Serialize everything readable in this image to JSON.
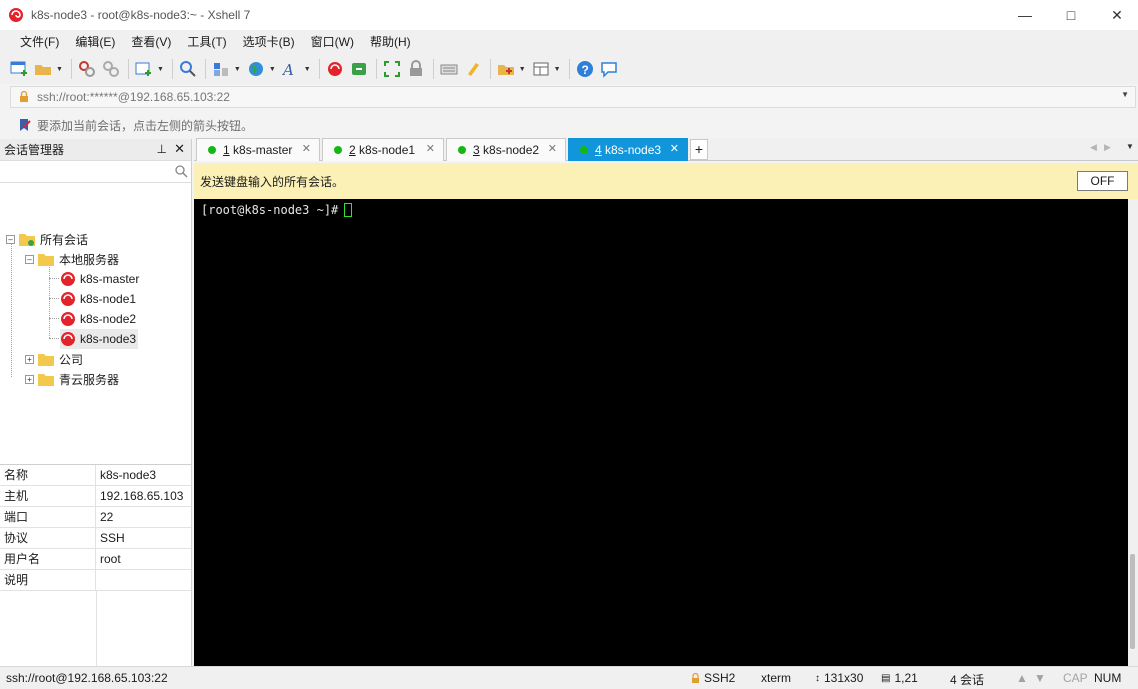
{
  "window": {
    "title": "k8s-node3 - root@k8s-node3:~ - Xshell 7",
    "minimize_icon": "minimize-icon",
    "maximize_icon": "maximize-icon",
    "close_icon": "close-icon"
  },
  "menu": [
    "文件(F)",
    "编辑(E)",
    "查看(V)",
    "工具(T)",
    "选项卡(B)",
    "窗口(W)",
    "帮助(H)"
  ],
  "toolbar_icons": [
    "new-session-icon",
    "open-folder-icon",
    "disconnect-icon",
    "reconnect-icon",
    "new-tab-icon",
    "find-icon",
    "transfer-icon",
    "globe-icon",
    "font-icon",
    "xshell-icon",
    "xftp-icon",
    "fullscreen-icon",
    "lock-icon",
    "keyboard-icon",
    "highlight-icon",
    "add-folder-icon",
    "layout-icon",
    "help-icon",
    "chat-icon"
  ],
  "address": {
    "value": "ssh://root:******@192.168.65.103:22"
  },
  "hint": {
    "text": "要添加当前会话，点击左侧的箭头按钮。"
  },
  "session_manager": {
    "title": "会话管理器",
    "tree": {
      "root": "所有会话",
      "local": "本地服务器",
      "sessions": [
        "k8s-master",
        "k8s-node1",
        "k8s-node2",
        "k8s-node3"
      ],
      "groups": [
        "公司",
        "青云服务器"
      ]
    },
    "properties": [
      {
        "key": "名称",
        "value": "k8s-node3"
      },
      {
        "key": "主机",
        "value": "192.168.65.103"
      },
      {
        "key": "端口",
        "value": "22"
      },
      {
        "key": "协议",
        "value": "SSH"
      },
      {
        "key": "用户名",
        "value": "root"
      },
      {
        "key": "说明",
        "value": ""
      }
    ]
  },
  "tabs": [
    {
      "num": "1",
      "label": "k8s-master",
      "active": false
    },
    {
      "num": "2",
      "label": "k8s-node1",
      "active": false
    },
    {
      "num": "3",
      "label": "k8s-node2",
      "active": false
    },
    {
      "num": "4",
      "label": "k8s-node3",
      "active": true
    }
  ],
  "tab_add": "+",
  "send_bar": {
    "text": "发送键盘输入的所有会话。",
    "toggle": "OFF"
  },
  "terminal": {
    "prompt": "[root@k8s-node3 ~]#"
  },
  "status": {
    "connection": "ssh://root@192.168.65.103:22",
    "protocol": "SSH2",
    "terminal_type": "xterm",
    "size": "131x30",
    "cursor_pos": "1,21",
    "sessions": "4 会话",
    "cap": "CAP",
    "num": "NUM"
  },
  "colors": {
    "accent": "#1296db",
    "online_dot": "#14b714",
    "send_bar_bg": "#fbf0b5",
    "terminal_bg": "#000000",
    "cursor": "#2fe32f"
  }
}
